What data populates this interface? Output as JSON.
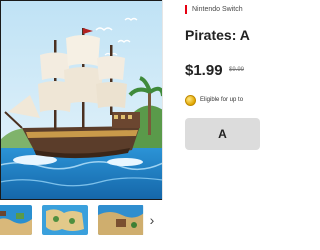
{
  "product": {
    "platform": "Nintendo Switch",
    "title": "Pirates: A",
    "price": "$1.99",
    "original_price": "$9.99",
    "points_text": "Eligible for up to",
    "cta_label": "A"
  },
  "gallery": {
    "thumbnail_count": 3,
    "next_icon": "chevron-right-icon"
  },
  "colors": {
    "platform_accent": "#e60012",
    "sea": "#1f7fc4",
    "sky": "#cfe8f5",
    "button": "#dcdcdc"
  }
}
